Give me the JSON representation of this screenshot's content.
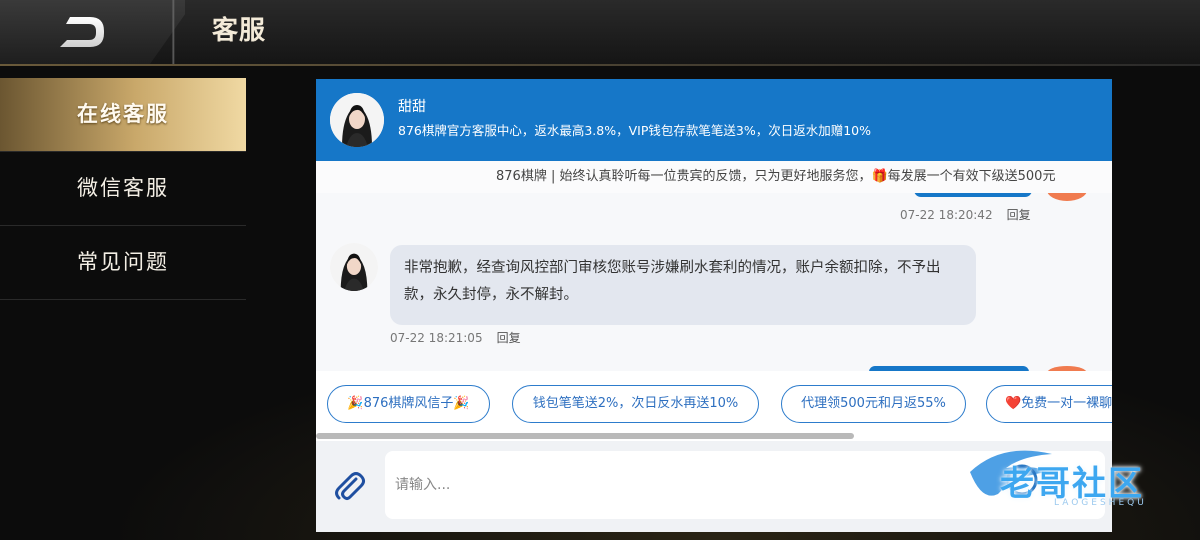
{
  "header": {
    "title": "客服"
  },
  "sidebar": {
    "items": [
      {
        "label": "在线客服",
        "active": true
      },
      {
        "label": "微信客服",
        "active": false
      },
      {
        "label": "常见问题",
        "active": false
      }
    ]
  },
  "chat": {
    "agent_name": "甜甜",
    "agent_desc": "876棋牌官方客服中心，返水最高3.8%，VIP钱包存款笔笔送3%，次日返水加赠10%",
    "marquee": "876棋牌 | 始终认真聆听每一位贵宾的反馈，只为更好地服务您，🎁每发展一个有效下级送500元",
    "messages": [
      {
        "time": "07-22 18:20:42",
        "reply": "回复"
      },
      {
        "text": "非常抱歉，经查询风控部门审核您账号涉嫌刷水套利的情况，账户余额扣除，不予出款，永久封停，永不解封。",
        "time": "07-22 18:21:05",
        "reply": "回复"
      }
    ],
    "quick_replies": [
      "🎉876棋牌风信子🎉",
      "钱包笔笔送2%，次日反水再送10%",
      "代理领500元和月返55%",
      "❤️免费一对一裸聊"
    ],
    "input_placeholder": "请输入..."
  },
  "watermark": {
    "text": "老哥社区",
    "sub": "LAOGESHEQU"
  },
  "colors": {
    "header_blue": "#1677c8",
    "gold": "#c9a86a",
    "quick_border": "#2d7ccc"
  }
}
